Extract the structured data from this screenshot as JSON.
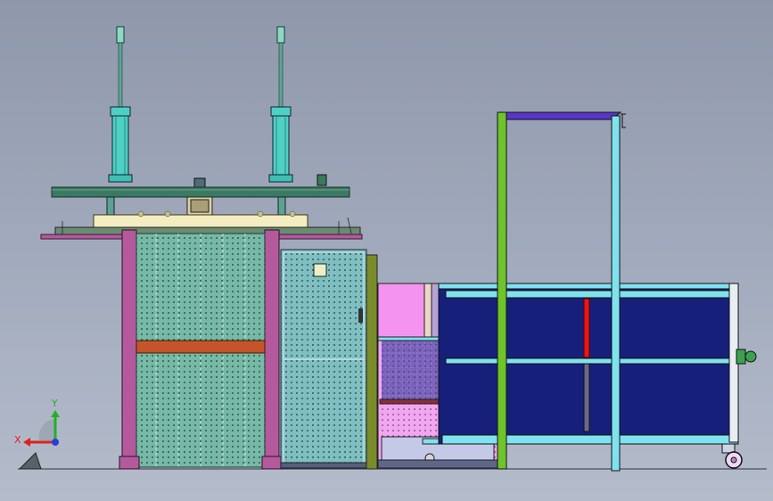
{
  "triad": {
    "x_label": "X",
    "y_label": "Y",
    "x_color": "#e0201c",
    "y_color": "#23b025",
    "z_color": "#2b3fd6"
  },
  "colors": {
    "background": "#a3acbe",
    "teal_plate": "#3b7a62",
    "cream_plate": "#f3edc1",
    "magenta_frame": "#b45a9c",
    "green_grid_panel": "#6fb8a6",
    "navy_cabinet": "#16207a",
    "cyan_frame": "#7fe3ef",
    "green_frame": "#6ec42a",
    "purple_top": "#5a35c9",
    "red_bar": "#e8151b",
    "pink_panel": "#f593f0",
    "cylinder": "#4fd0c4"
  }
}
